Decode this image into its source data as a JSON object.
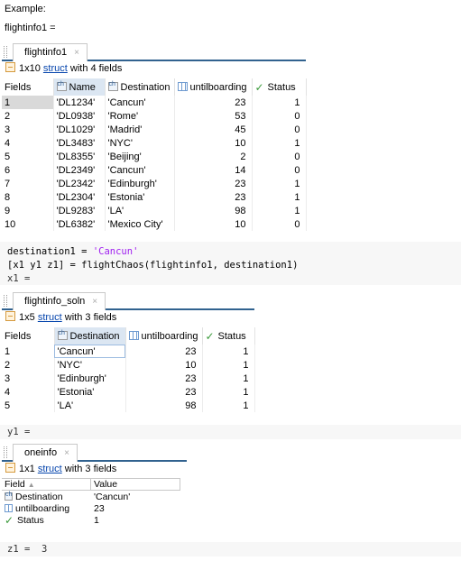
{
  "example_label": "Example:",
  "var1_label": "flightinfo1 =",
  "panel1": {
    "tab": "flightinfo1",
    "close": "×",
    "info_prefix": "1x10",
    "info_link": "struct",
    "info_suffix": "with 4 fields",
    "corner": "Fields",
    "columns": [
      "Name",
      "Destination",
      "untilboarding",
      "Status"
    ],
    "rows": [
      [
        "1",
        "'DL1234'",
        "'Cancun'",
        "23",
        "1"
      ],
      [
        "2",
        "'DL0938'",
        "'Rome'",
        "53",
        "0"
      ],
      [
        "3",
        "'DL1029'",
        "'Madrid'",
        "45",
        "0"
      ],
      [
        "4",
        "'DL3483'",
        "'NYC'",
        "10",
        "1"
      ],
      [
        "5",
        "'DL8355'",
        "'Beijing'",
        "2",
        "0"
      ],
      [
        "6",
        "'DL2349'",
        "'Cancun'",
        "14",
        "0"
      ],
      [
        "7",
        "'DL2342'",
        "'Edinburgh'",
        "23",
        "1"
      ],
      [
        "8",
        "'DL2304'",
        "'Estonia'",
        "23",
        "1"
      ],
      [
        "9",
        "'DL9283'",
        "'LA'",
        "98",
        "1"
      ],
      [
        "10",
        "'DL6382'",
        "'Mexico City'",
        "10",
        "0"
      ]
    ]
  },
  "code": {
    "line1_a": "destination1 = ",
    "line1_b": "'Cancun'",
    "line2": "[x1 y1 z1] = flightChaos(flightinfo1, destination1)",
    "line3": "x1 ="
  },
  "panel2": {
    "tab": "flightinfo_soln",
    "close": "×",
    "info_prefix": "1x5",
    "info_link": "struct",
    "info_suffix": "with 3 fields",
    "corner": "Fields",
    "columns": [
      "Destination",
      "untilboarding",
      "Status"
    ],
    "rows": [
      [
        "1",
        "'Cancun'",
        "23",
        "1"
      ],
      [
        "2",
        "'NYC'",
        "10",
        "1"
      ],
      [
        "3",
        "'Edinburgh'",
        "23",
        "1"
      ],
      [
        "4",
        "'Estonia'",
        "23",
        "1"
      ],
      [
        "5",
        "'LA'",
        "98",
        "1"
      ]
    ]
  },
  "y1_label": "y1 =",
  "panel3": {
    "tab": "oneinfo",
    "close": "×",
    "info_prefix": "1x1",
    "info_link": "struct",
    "info_suffix": "with 3 fields",
    "col_field": "Field",
    "sort_arrow": "▲",
    "col_value": "Value",
    "rows": [
      {
        "icon": "string-icon",
        "field": "Destination",
        "value": "'Cancun'"
      },
      {
        "icon": "numeric-icon",
        "field": "untilboarding",
        "value": "23"
      },
      {
        "icon": "logical-icon",
        "field": "Status",
        "value": "1"
      }
    ]
  },
  "z1_label": "z1 =",
  "z1_value": "3",
  "colors": {
    "tab_underline": "#31628f",
    "code_bg": "#f7f7f7",
    "string_literal": "#a020f0",
    "link": "#0645ad"
  }
}
